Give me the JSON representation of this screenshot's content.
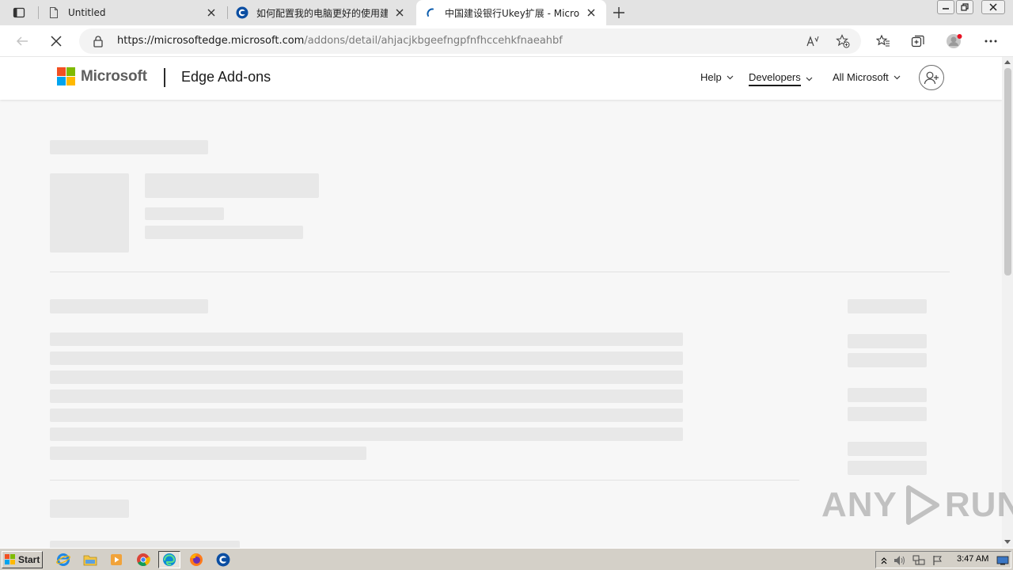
{
  "browser": {
    "tabs": [
      {
        "title": "Untitled",
        "favicon": "page-icon",
        "active": false
      },
      {
        "title": "如何配置我的电脑更好的使用建行",
        "favicon": "ccb-icon",
        "active": false
      },
      {
        "title": "中国建设银行Ukey扩展 - Microsoft Edge Add-ons",
        "favicon": "loading-spinner-icon",
        "active": true
      }
    ],
    "address_bar": {
      "url_host": "https://microsoftedge.microsoft.com",
      "url_path": "/addons/detail/ahjacjkbgeefngpfnfhccehkfnaeahbf"
    }
  },
  "site": {
    "brand": "Microsoft",
    "product": "Edge Add-ons",
    "nav": [
      {
        "label": "Help",
        "current": false
      },
      {
        "label": "Developers",
        "current": true
      },
      {
        "label": "All Microsoft",
        "current": false
      }
    ],
    "logo_colors": [
      "#f25022",
      "#7fba00",
      "#00a4ef",
      "#ffb900"
    ]
  },
  "watermark": {
    "left": "ANY",
    "right": "RUN"
  },
  "taskbar": {
    "start_label": "Start",
    "apps": [
      "ie-icon",
      "explorer-icon",
      "media-player-icon",
      "chrome-icon",
      "edge-icon",
      "firefox-icon",
      "ccb-app-icon"
    ],
    "clock": "3:47 AM"
  }
}
